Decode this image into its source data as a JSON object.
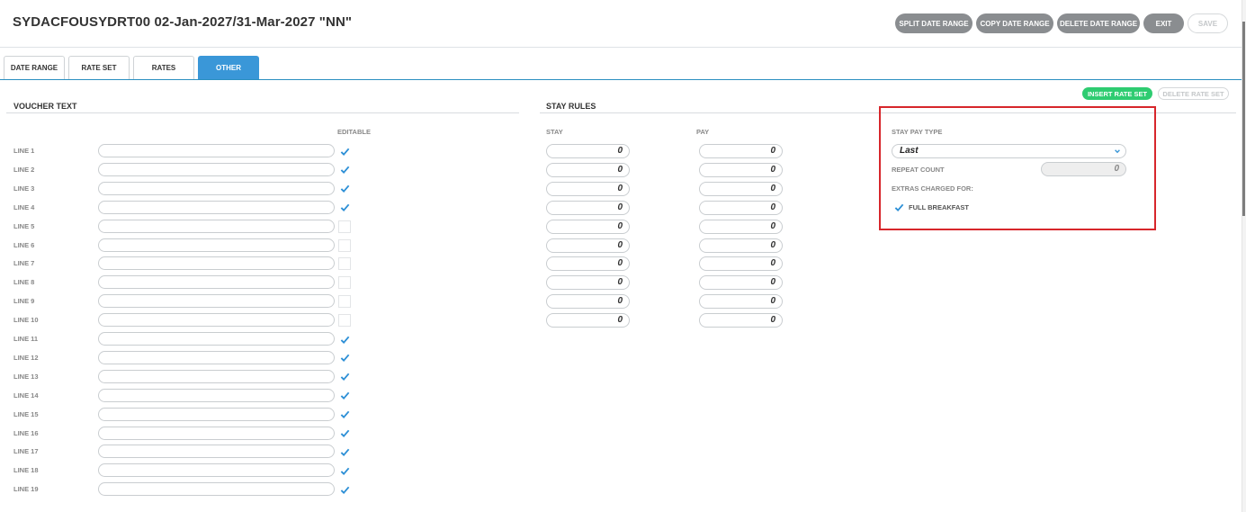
{
  "header": {
    "title": "SYDACFOUSYDRT00 02-Jan-2027/31-Mar-2027 \"NN\"",
    "actions": [
      "SPLIT DATE RANGE",
      "COPY DATE RANGE",
      "DELETE DATE RANGE",
      "EXIT",
      "SAVE"
    ]
  },
  "tabs": [
    "DATE RANGE",
    "RATE SET",
    "RATES",
    "OTHER"
  ],
  "active_tab": "OTHER",
  "rate_set_actions": {
    "insert": "INSERT RATE SET",
    "delete": "DELETE RATE SET"
  },
  "voucher_text": {
    "title": "VOUCHER TEXT",
    "editable_header": "EDITABLE",
    "lines": [
      {
        "label": "LINE 1",
        "value": "",
        "editable": true
      },
      {
        "label": "LINE 2",
        "value": "",
        "editable": true
      },
      {
        "label": "LINE 3",
        "value": "",
        "editable": true
      },
      {
        "label": "LINE 4",
        "value": "",
        "editable": true
      },
      {
        "label": "LINE 5",
        "value": "",
        "editable": false
      },
      {
        "label": "LINE 6",
        "value": "",
        "editable": false
      },
      {
        "label": "LINE 7",
        "value": "",
        "editable": false
      },
      {
        "label": "LINE 8",
        "value": "",
        "editable": false
      },
      {
        "label": "LINE 9",
        "value": "",
        "editable": false
      },
      {
        "label": "LINE 10",
        "value": "",
        "editable": false
      },
      {
        "label": "LINE 11",
        "value": "",
        "editable": true
      },
      {
        "label": "LINE 12",
        "value": "",
        "editable": true
      },
      {
        "label": "LINE 13",
        "value": "",
        "editable": true
      },
      {
        "label": "LINE 14",
        "value": "",
        "editable": true
      },
      {
        "label": "LINE 15",
        "value": "",
        "editable": true
      },
      {
        "label": "LINE 16",
        "value": "",
        "editable": true
      },
      {
        "label": "LINE 17",
        "value": "",
        "editable": true
      },
      {
        "label": "LINE 18",
        "value": "",
        "editable": true
      },
      {
        "label": "LINE 19",
        "value": "",
        "editable": true
      }
    ]
  },
  "stay_rules": {
    "title": "STAY RULES",
    "stay_header": "STAY",
    "pay_header": "PAY",
    "rows": [
      {
        "stay": "0",
        "pay": "0"
      },
      {
        "stay": "0",
        "pay": "0"
      },
      {
        "stay": "0",
        "pay": "0"
      },
      {
        "stay": "0",
        "pay": "0"
      },
      {
        "stay": "0",
        "pay": "0"
      },
      {
        "stay": "0",
        "pay": "0"
      },
      {
        "stay": "0",
        "pay": "0"
      },
      {
        "stay": "0",
        "pay": "0"
      },
      {
        "stay": "0",
        "pay": "0"
      },
      {
        "stay": "0",
        "pay": "0"
      }
    ]
  },
  "stay_pay": {
    "type_label": "STAY PAY TYPE",
    "type_value": "Last",
    "repeat_label": "REPEAT COUNT",
    "repeat_value": "0",
    "extras_label": "EXTRAS CHARGED FOR:",
    "extras": [
      {
        "label": "FULL BREAKFAST",
        "checked": true
      }
    ]
  },
  "colors": {
    "accent": "#3a97d8",
    "green": "#2ecc71",
    "gray_button": "#8a8d90",
    "highlight": "#d7262b"
  }
}
